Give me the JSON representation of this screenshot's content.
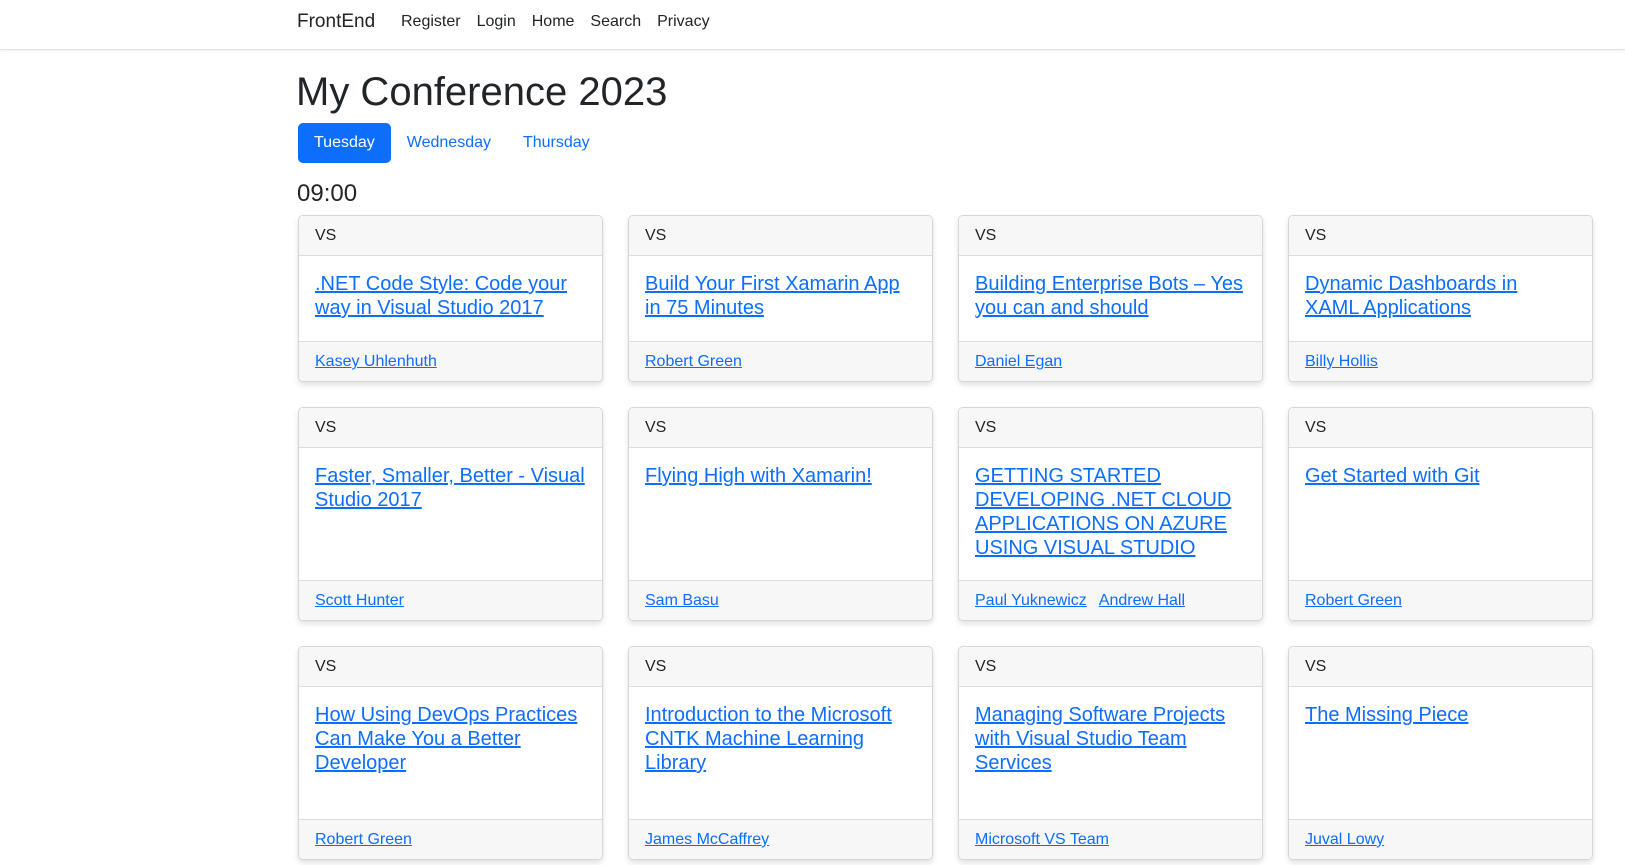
{
  "navbar": {
    "brand": "FrontEnd",
    "links": [
      "Register",
      "Login",
      "Home",
      "Search",
      "Privacy"
    ]
  },
  "page": {
    "title": "My Conference 2023",
    "days": [
      "Tuesday",
      "Wednesday",
      "Thursday"
    ],
    "active_day": "Tuesday",
    "time_slot": "09:00"
  },
  "sessions": [
    {
      "track": "VS",
      "title": ".NET Code Style: Code your way in Visual Studio 2017",
      "speakers": [
        "Kasey Uhlenhuth"
      ]
    },
    {
      "track": "VS",
      "title": "Build Your First Xamarin App in 75 Minutes",
      "speakers": [
        "Robert Green"
      ]
    },
    {
      "track": "VS",
      "title": "Building Enterprise Bots – Yes you can and should",
      "speakers": [
        "Daniel Egan"
      ]
    },
    {
      "track": "VS",
      "title": "Dynamic Dashboards in XAML Applications",
      "speakers": [
        "Billy Hollis"
      ]
    },
    {
      "track": "VS",
      "title": "Faster, Smaller, Better - Visual Studio 2017",
      "speakers": [
        "Scott Hunter"
      ]
    },
    {
      "track": "VS",
      "title": "Flying High with Xamarin!",
      "speakers": [
        "Sam Basu"
      ]
    },
    {
      "track": "VS",
      "title": "GETTING STARTED DEVELOPING .NET CLOUD APPLICATIONS ON AZURE USING VISUAL STUDIO",
      "speakers": [
        "Paul Yuknewicz",
        "Andrew Hall"
      ]
    },
    {
      "track": "VS",
      "title": "Get Started with Git",
      "speakers": [
        "Robert Green"
      ]
    },
    {
      "track": "VS",
      "title": "How Using DevOps Practices Can Make You a Better Developer",
      "speakers": [
        "Robert Green"
      ]
    },
    {
      "track": "VS",
      "title": "Introduction to the Microsoft CNTK Machine Learning Library",
      "speakers": [
        "James McCaffrey"
      ]
    },
    {
      "track": "VS",
      "title": "Managing Software Projects with Visual Studio Team Services",
      "speakers": [
        "Microsoft VS Team"
      ]
    },
    {
      "track": "VS",
      "title": "The Missing Piece",
      "speakers": [
        "Juval Lowy"
      ]
    }
  ],
  "colors": {
    "accent": "#0d6efd",
    "card_header_bg": "#f7f7f7"
  }
}
